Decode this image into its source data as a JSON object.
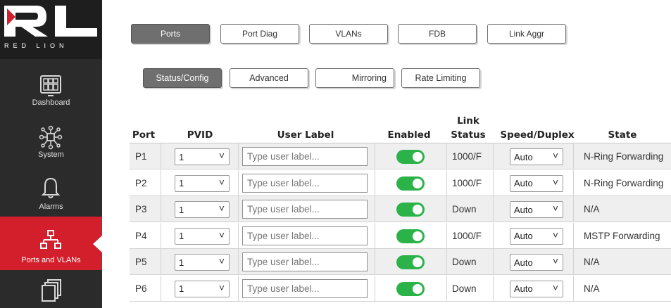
{
  "brand": {
    "logo_text": "RED LION",
    "accent_color": "#d21f2b"
  },
  "sidebar": {
    "items": [
      {
        "label": "Dashboard",
        "icon": "dashboard-icon"
      },
      {
        "label": "System",
        "icon": "system-network-icon"
      },
      {
        "label": "Alarms",
        "icon": "bell-icon"
      },
      {
        "label": "Ports and VLANs",
        "icon": "ports-network-icon",
        "active": true
      },
      {
        "label": "",
        "icon": "copy-pages-icon"
      }
    ]
  },
  "top_tabs": [
    {
      "label": "Ports",
      "active": true
    },
    {
      "label": "Port Diag"
    },
    {
      "label": "VLANs"
    },
    {
      "label": "FDB"
    },
    {
      "label": "Link Aggr"
    }
  ],
  "sub_tabs": [
    {
      "label": "Status/Config",
      "active": true
    },
    {
      "label": "Advanced"
    },
    {
      "label": "Mirroring"
    },
    {
      "label": "Rate Limiting"
    }
  ],
  "table": {
    "headers": {
      "port": "Port",
      "pvid": "PVID",
      "user_label": "User Label",
      "enabled": "Enabled",
      "link_status_line1": "Link",
      "link_status_line2": "Status",
      "speed_duplex": "Speed/Duplex",
      "state": "State"
    },
    "placeholder": "Type user label...",
    "rows": [
      {
        "port": "P1",
        "pvid": "1",
        "enabled": true,
        "link_status": "1000/F",
        "speed_duplex": "Auto",
        "state": "N-Ring Forwarding"
      },
      {
        "port": "P2",
        "pvid": "1",
        "enabled": true,
        "link_status": "1000/F",
        "speed_duplex": "Auto",
        "state": "N-Ring Forwarding"
      },
      {
        "port": "P3",
        "pvid": "1",
        "enabled": true,
        "link_status": "Down",
        "speed_duplex": "Auto",
        "state": "N/A"
      },
      {
        "port": "P4",
        "pvid": "1",
        "enabled": true,
        "link_status": "1000/F",
        "speed_duplex": "Auto",
        "state": "MSTP Forwarding"
      },
      {
        "port": "P5",
        "pvid": "1",
        "enabled": true,
        "link_status": "Down",
        "speed_duplex": "Auto",
        "state": "N/A"
      },
      {
        "port": "P6",
        "pvid": "1",
        "enabled": true,
        "link_status": "Down",
        "speed_duplex": "Auto",
        "state": "N/A"
      }
    ]
  }
}
